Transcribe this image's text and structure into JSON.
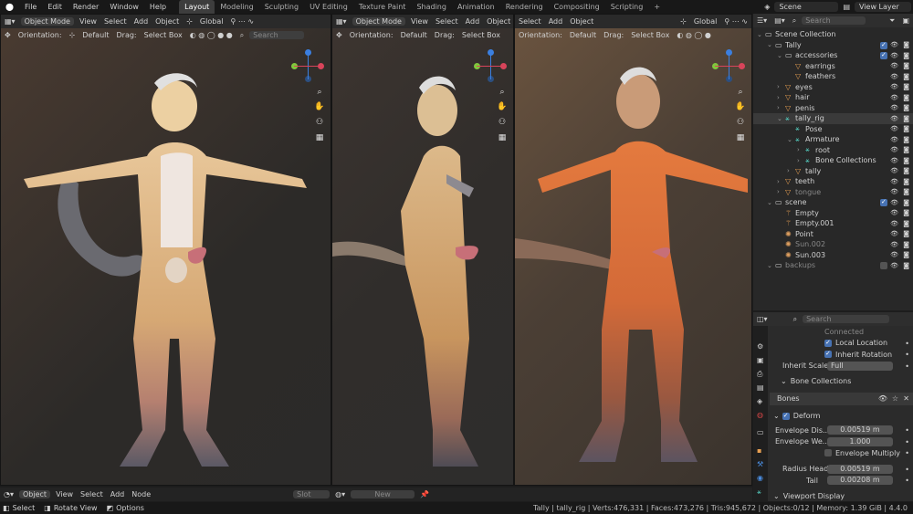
{
  "menu": [
    "File",
    "Edit",
    "Render",
    "Window",
    "Help"
  ],
  "workspaces": [
    "Layout",
    "Modeling",
    "Sculpting",
    "UV Editing",
    "Texture Paint",
    "Shading",
    "Animation",
    "Rendering",
    "Compositing",
    "Scripting"
  ],
  "scene": "Scene",
  "view_layer": "View Layer",
  "viewport1": {
    "mode": "Object Mode",
    "menus": [
      "View",
      "Select",
      "Add",
      "Object"
    ],
    "transform": "Global",
    "orientation_label": "Orientation:",
    "orientation": "Default",
    "drag_label": "Drag:",
    "drag": "Select Box",
    "search": "Search"
  },
  "viewport2": {
    "mode": "Object Mode",
    "menus": [
      "View",
      "Select",
      "Add",
      "Object"
    ],
    "orientation_label": "Orientation:",
    "orientation": "Default",
    "drag_label": "Drag:",
    "drag": "Select Box"
  },
  "viewport3": {
    "menus": [
      "Select",
      "Add",
      "Object"
    ],
    "transform": "Global",
    "orientation_label": "Orientation:",
    "orientation": "Default",
    "drag_label": "Drag:",
    "drag": "Select Box"
  },
  "outliner": {
    "search": "Search",
    "items": [
      {
        "label": "Scene Collection",
        "indent": 0
      },
      {
        "label": "Tally",
        "indent": 1
      },
      {
        "label": "accessories",
        "indent": 2
      },
      {
        "label": "earrings",
        "indent": 3
      },
      {
        "label": "feathers",
        "indent": 3
      },
      {
        "label": "eyes",
        "indent": 2
      },
      {
        "label": "hair",
        "indent": 2
      },
      {
        "label": "penis",
        "indent": 2
      },
      {
        "label": "tally_rig",
        "indent": 2
      },
      {
        "label": "Pose",
        "indent": 3
      },
      {
        "label": "Armature",
        "indent": 3
      },
      {
        "label": "root",
        "indent": 4
      },
      {
        "label": "Bone Collections",
        "indent": 4
      },
      {
        "label": "tally",
        "indent": 3
      },
      {
        "label": "teeth",
        "indent": 2
      },
      {
        "label": "tongue",
        "indent": 2
      },
      {
        "label": "scene",
        "indent": 1
      },
      {
        "label": "Empty",
        "indent": 2
      },
      {
        "label": "Empty.001",
        "indent": 2
      },
      {
        "label": "Point",
        "indent": 2
      },
      {
        "label": "Sun.002",
        "indent": 2
      },
      {
        "label": "Sun.003",
        "indent": 2
      },
      {
        "label": "backups",
        "indent": 1
      }
    ]
  },
  "properties": {
    "search": "Search",
    "connected": "Connected",
    "local_location": "Local Location",
    "inherit_rotation": "Inherit Rotation",
    "inherit_scale_label": "Inherit Scale",
    "inherit_scale": "Full",
    "bone_collections": "Bone Collections",
    "bones": "Bones",
    "deform": "Deform",
    "env_dist_label": "Envelope Dis...",
    "env_dist": "0.00519 m",
    "env_weight_label": "Envelope We...",
    "env_weight": "1.000",
    "env_mult": "Envelope Multiply",
    "radius_head_label": "Radius Head",
    "radius_head": "0.00519 m",
    "tail_label": "Tail",
    "tail": "0.00208 m",
    "viewport_display": "Viewport Display"
  },
  "timeline": {
    "mode": "Object",
    "menus": [
      "View",
      "Select",
      "Add",
      "Node"
    ],
    "slot": "Slot",
    "new": "New"
  },
  "status": {
    "select": "Select",
    "rotate": "Rotate View",
    "options": "Options",
    "info": "Tally | tally_rig | Verts:476,331 | Faces:473,276 | Tris:945,672 | Objects:0/12 | Memory: 1.39 GiB | 4.4.0"
  },
  "colors": {
    "accent": "#4772b3",
    "collection": "#cfcfcf",
    "armature": "#55d1c3",
    "mesh": "#e8a052"
  }
}
